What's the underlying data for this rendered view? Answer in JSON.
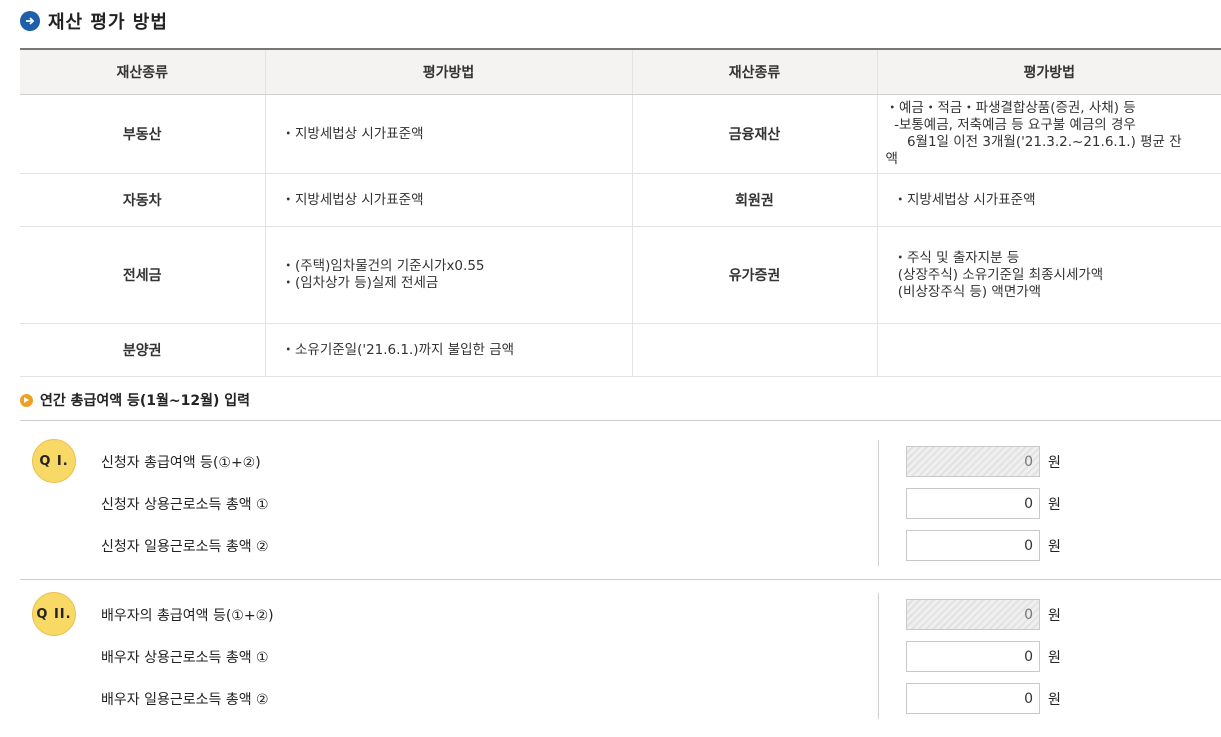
{
  "header": {
    "title": "재산 평가 방법"
  },
  "table": {
    "headers": [
      "재산종류",
      "평가방법",
      "재산종류",
      "평가방법"
    ],
    "rows": [
      {
        "kind1": "부동산",
        "method1": "・지방세법상 시가표준액",
        "kind2": "금융재산",
        "method2": "・예금・적금・파생결합상품(증권, 사채) 등\n  -보통예금, 저축예금 등 요구불 예금의 경우\n     6월1일 이전 3개월('21.3.2.~21.6.1.) 평균 잔\n액"
      },
      {
        "kind1": "자동차",
        "method1": "・지방세법상 시가표준액",
        "kind2": "회원권",
        "method2": "・지방세법상 시가표준액"
      },
      {
        "kind1": "전세금",
        "method1": "・(주택)임차물건의 기준시가x0.55\n・(임차상가 등)실제 전세금",
        "kind2": "유가증권",
        "method2": "・주식 및 출자지분 등\n (상장주식) 소유기준일 최종시세가액\n (비상장주식 등) 액면가액"
      },
      {
        "kind1": "분양권",
        "method1": "・소유기준일('21.6.1.)까지 불입한 금액",
        "kind2": "",
        "method2": ""
      }
    ]
  },
  "income_section": {
    "title": "연간 총급여액 등(1월~12월) 입력",
    "unit": "원",
    "q1": {
      "badge": "Q I.",
      "rows": [
        {
          "label": "신청자 총급여액 등(①+②)",
          "value": "0",
          "readonly": true
        },
        {
          "label": "신청자 상용근로소득 총액 ①",
          "value": "0",
          "readonly": false
        },
        {
          "label": "신청자 일용근로소득 총액 ②",
          "value": "0",
          "readonly": false
        }
      ]
    },
    "q2": {
      "badge": "Q II.",
      "rows": [
        {
          "label": "배우자의 총급여액 등(①+②)",
          "value": "0",
          "readonly": true
        },
        {
          "label": "배우자 상용근로소득 총액 ①",
          "value": "0",
          "readonly": false
        },
        {
          "label": "배우자 일용근로소득 총액 ②",
          "value": "0",
          "readonly": false
        }
      ]
    }
  }
}
